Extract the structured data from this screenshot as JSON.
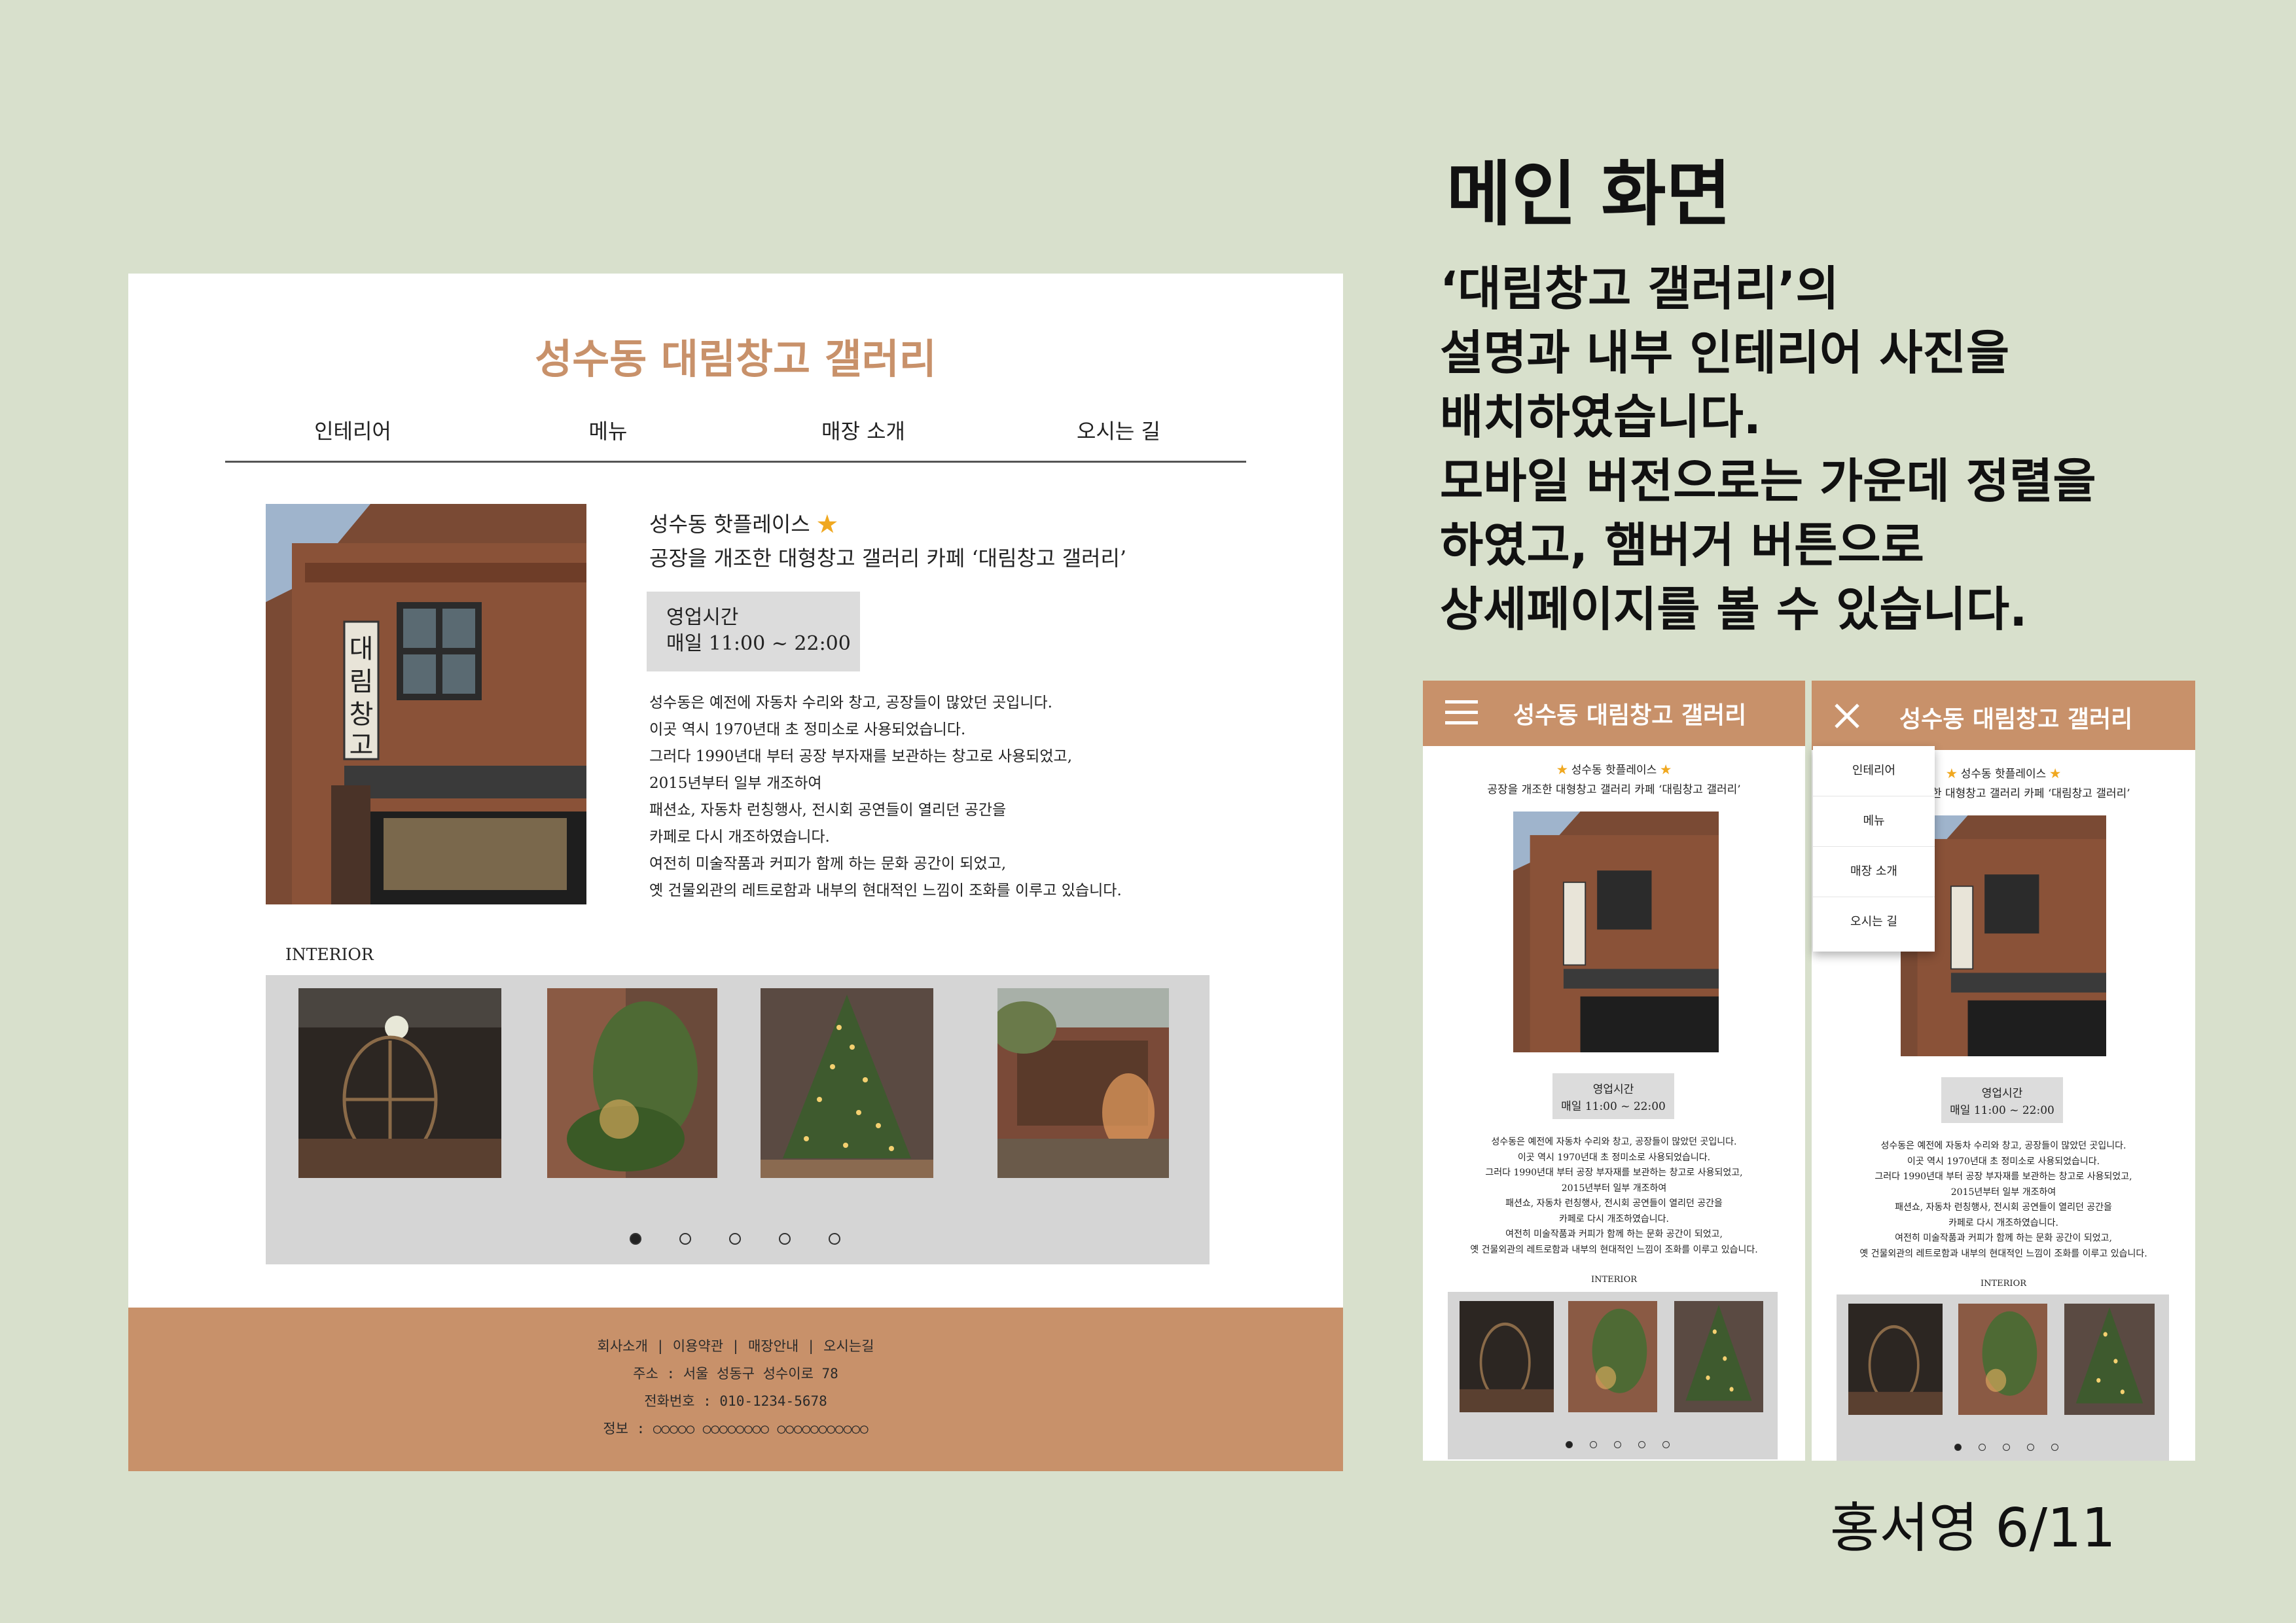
{
  "right_panel": {
    "heading": "메인 화면",
    "description_lines": [
      "‘대림창고 갤러리’의",
      "설명과 내부 인테리어 사진을",
      "배치하였습니다.",
      "모바일 버전으로는 가운데 정렬을",
      "하였고, 햄버거 버튼으로",
      "상세페이지를 볼 수 있습니다."
    ],
    "author": "홍서영 6/11"
  },
  "site": {
    "title": "성수동 대림창고 갤러리",
    "nav": [
      "인테리어",
      "메뉴",
      "매장 소개",
      "오시는 길"
    ],
    "subtitle": "성수동 핫플레이스",
    "star": "★",
    "tagline": "공장을 개조한 대형창고 갤러리 카페 ‘대림창고 갤러리’",
    "hours_label": "영업시간",
    "hours_value": "매일 11:00 ~ 22:00",
    "body_lines": [
      "성수동은 예전에 자동차 수리와 창고, 공장들이 많았던 곳입니다.",
      "이곳 역시 1970년대 초 정미소로 사용되었습니다.",
      "그러다 1990년대 부터 공장 부자재를 보관하는 창고로 사용되었고,",
      "2015년부터 일부 개조하여",
      "패션쇼, 자동차 런칭행사, 전시회 공연들이 열리던 공간을",
      "카페로 다시 개조하였습니다.",
      "여전히 미술작품과 커피가 함께 하는 문화 공간이 되었고,",
      "옛 건물외관의 레트로함과 내부의 현대적인 느낌이 조화를 이루고 있습니다."
    ],
    "interior_label": "INTERIOR",
    "carousel_active": 1,
    "carousel_total": 5,
    "footer": {
      "links": "회사소개 | 이용약관 | 매장안내 | 오시는길",
      "address": "주소 : 서울 성동구 성수이로 78",
      "phone": "전화번호 : 010-1234-5678",
      "info": "정보 : ○○○○○ ○○○○○○○○ ○○○○○○○○○○○"
    }
  },
  "colors": {
    "background": "#d8e0cc",
    "accent": "#c8916a",
    "hours_box": "#dcdcdc",
    "gallery_bg": "#d5d5d5"
  },
  "icons": {
    "mobile_menu": "hamburger-icon",
    "mobile_close": "close-icon"
  }
}
